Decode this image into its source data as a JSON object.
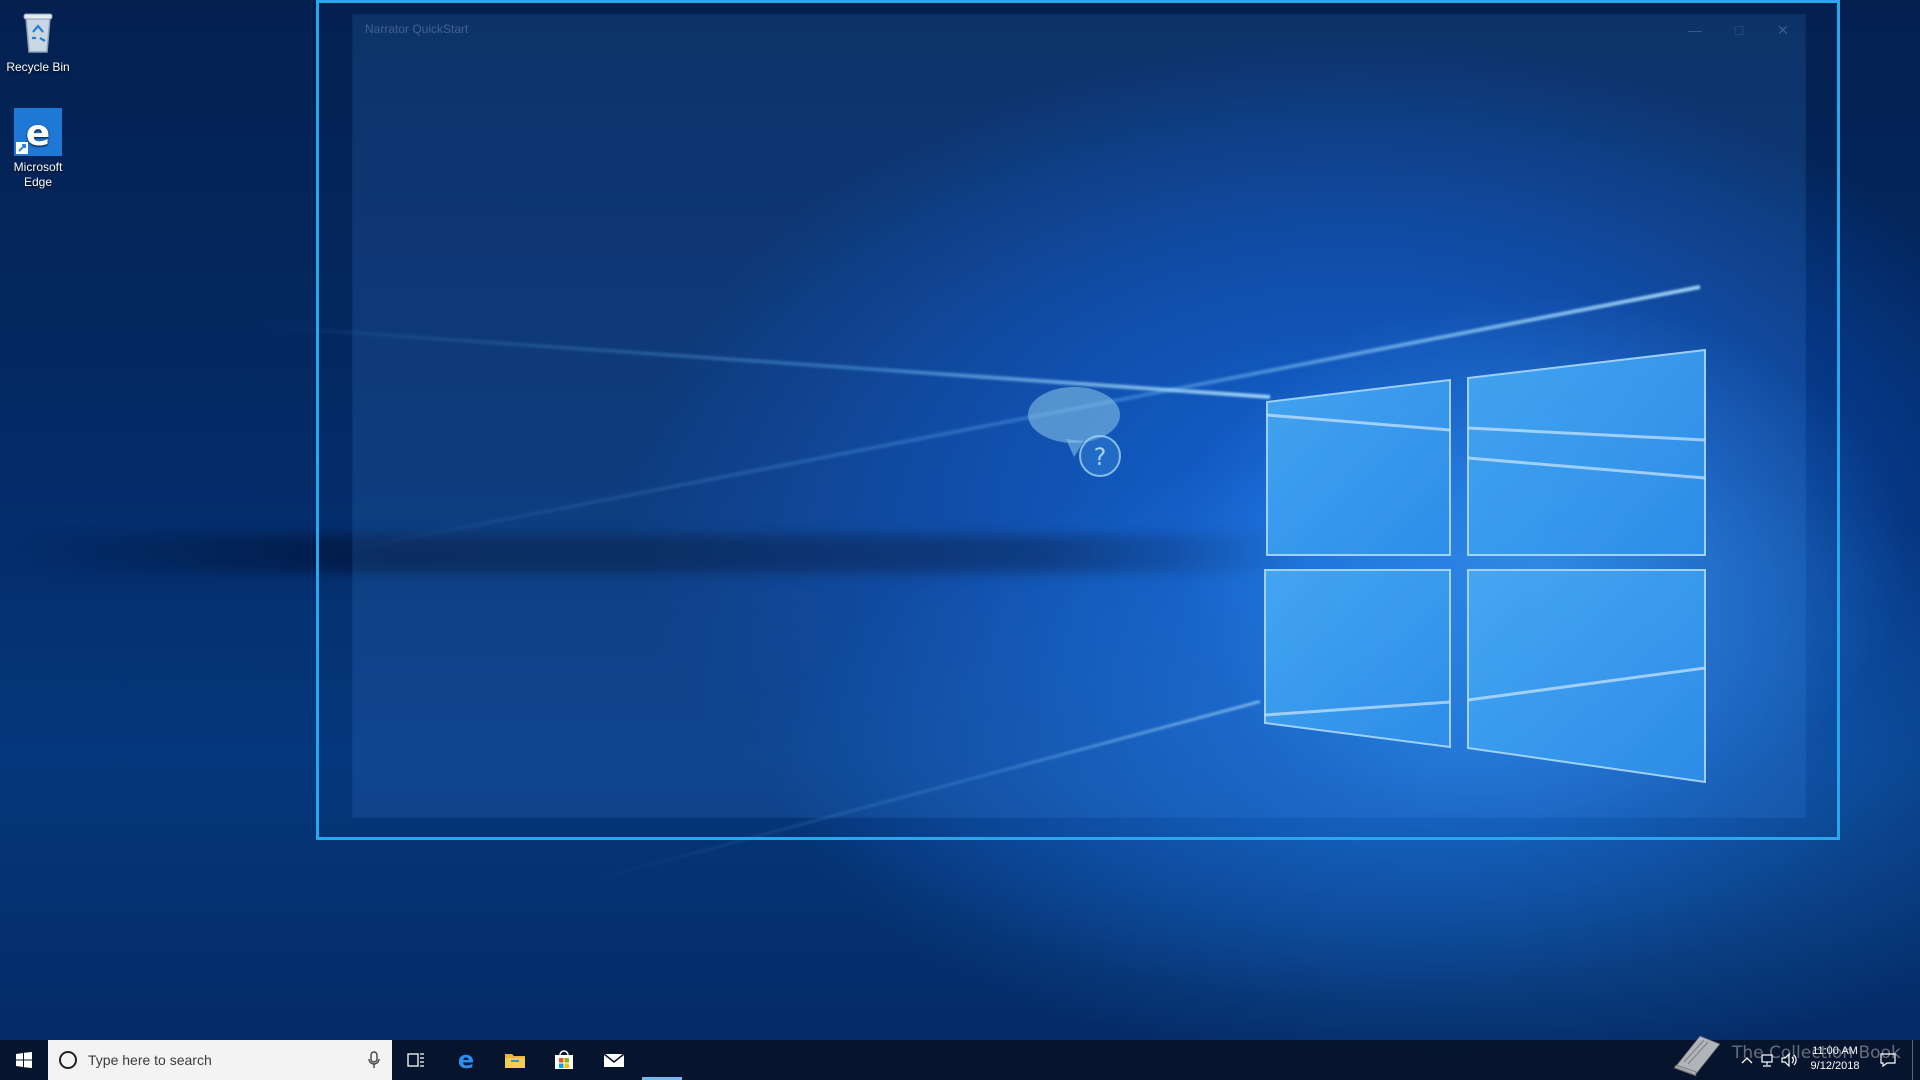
{
  "desktop": {
    "icons": [
      {
        "label": "Recycle Bin",
        "icon": "recycle-bin-icon"
      },
      {
        "label": "Microsoft Edge",
        "icon": "edge-icon"
      }
    ]
  },
  "narrator_window": {
    "title": "Narrator QuickStart",
    "controls": [
      "minimize",
      "maximize",
      "close"
    ],
    "content_icon": "speech-bubble-question-icon",
    "focus_color": "#27a8ee"
  },
  "taskbar": {
    "start_icon": "windows-start-icon",
    "search": {
      "placeholder": "Type here to search"
    },
    "pinned": [
      {
        "name": "task-view-icon"
      },
      {
        "name": "edge-icon"
      },
      {
        "name": "file-explorer-icon"
      },
      {
        "name": "store-icon"
      },
      {
        "name": "mail-icon"
      }
    ],
    "tray_icons": [
      "chevron-up-icon",
      "network-icon",
      "volume-icon"
    ],
    "clock": {
      "time": "11:00 AM",
      "date": "9/12/2018"
    },
    "notification_icon": "action-center-icon"
  },
  "watermark": {
    "text": "The Collection Book"
  },
  "colors": {
    "accent": "#27a8ee",
    "taskbar": "#06142c",
    "wallpaper": "#0a5bd0"
  }
}
